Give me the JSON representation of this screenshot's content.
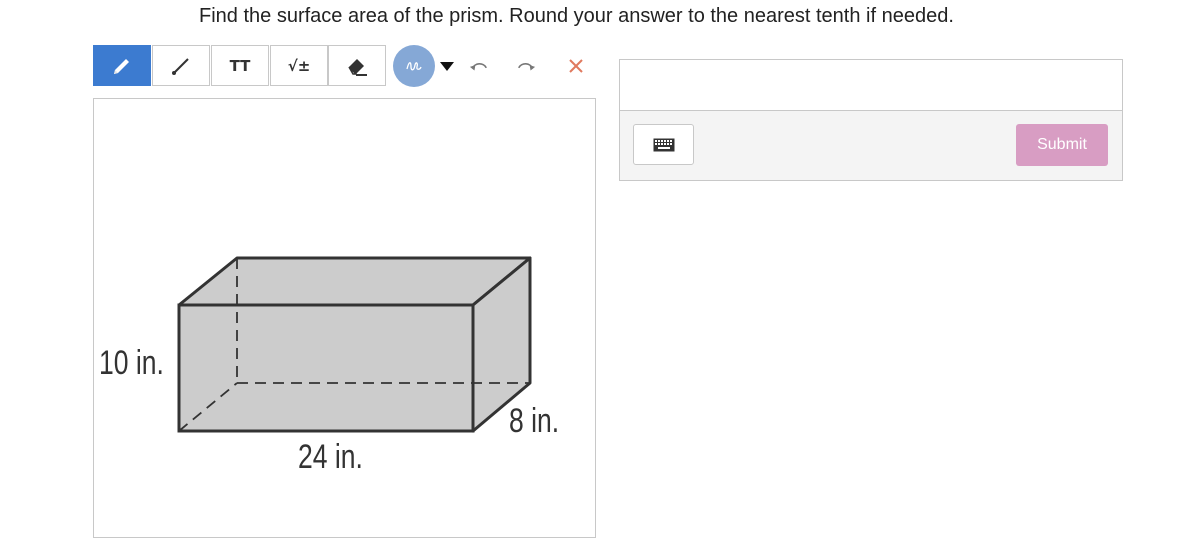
{
  "question": {
    "text": "Find the surface area of the prism. Round your answer to the nearest tenth if needed."
  },
  "toolbar": {
    "text_tool_label": "TT",
    "math_tool_label": "√±",
    "active_tool": "pencil",
    "active_color": "#3c7bd0",
    "icons": [
      "pencil-icon",
      "line-icon",
      "text-icon",
      "math-icon",
      "eraser-icon",
      "scribble-icon",
      "dropdown-arrow-icon",
      "undo-icon",
      "redo-icon",
      "clear-icon"
    ]
  },
  "figure": {
    "height_label": "10 in.",
    "length_label": "24 in.",
    "width_label": "8 in.",
    "face_color": "#cccccc"
  },
  "answer": {
    "input_value": "",
    "keyboard_icon": "keyboard-icon",
    "submit_label": "Submit",
    "submit_color": "#d89dc3"
  }
}
